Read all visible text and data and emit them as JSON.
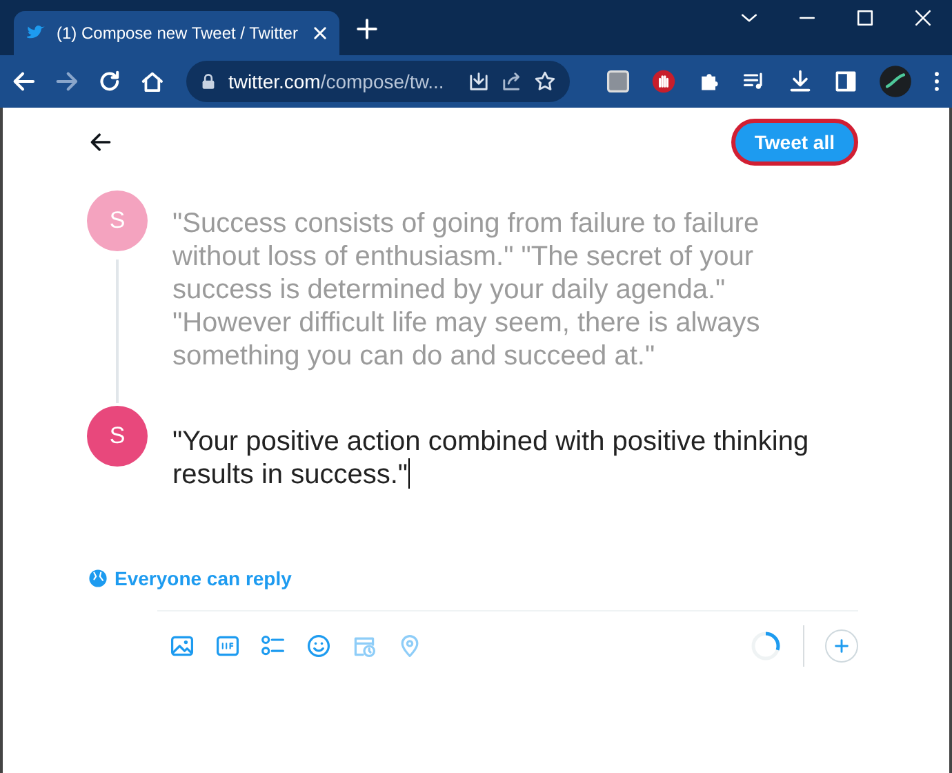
{
  "browser": {
    "tab": {
      "title": "(1) Compose new Tweet / Twitter"
    },
    "address": {
      "host": "twitter.com",
      "path": "/compose/tw..."
    }
  },
  "compose": {
    "button": "Tweet all",
    "tweets": [
      {
        "avatar": "S",
        "color": "#f4a3bf",
        "kind": "posted",
        "text": "\"Success consists of going from failure to failure without loss of enthusiasm.\" \"The secret of your success is determined by your daily agenda.\" \"However difficult life may seem, there is always something you can do and succeed at.\""
      },
      {
        "avatar": "S",
        "color": "#e8487c",
        "kind": "editing",
        "text": " \"Your positive action combined with positive thinking results in success.\""
      }
    ],
    "reply_setting": "Everyone can reply",
    "char_count": {
      "level": 0.3
    }
  }
}
